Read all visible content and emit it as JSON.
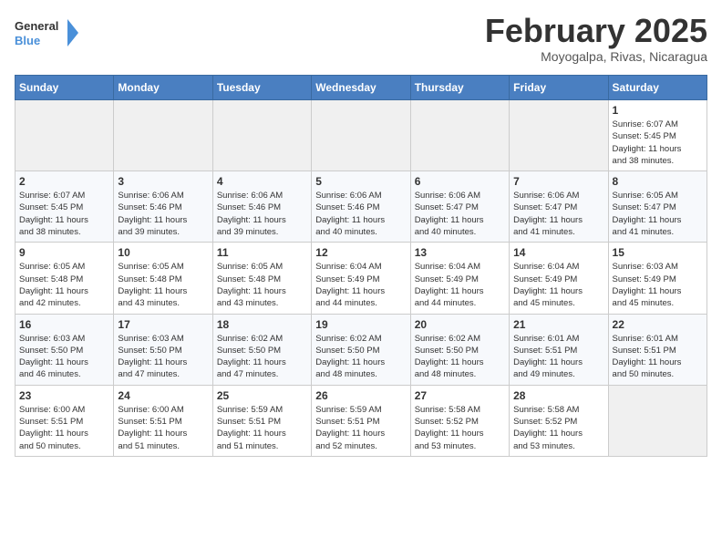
{
  "header": {
    "logo_line1": "General",
    "logo_line2": "Blue",
    "month": "February 2025",
    "location": "Moyogalpa, Rivas, Nicaragua"
  },
  "weekdays": [
    "Sunday",
    "Monday",
    "Tuesday",
    "Wednesday",
    "Thursday",
    "Friday",
    "Saturday"
  ],
  "weeks": [
    [
      {
        "day": "",
        "info": ""
      },
      {
        "day": "",
        "info": ""
      },
      {
        "day": "",
        "info": ""
      },
      {
        "day": "",
        "info": ""
      },
      {
        "day": "",
        "info": ""
      },
      {
        "day": "",
        "info": ""
      },
      {
        "day": "1",
        "info": "Sunrise: 6:07 AM\nSunset: 5:45 PM\nDaylight: 11 hours\nand 38 minutes."
      }
    ],
    [
      {
        "day": "2",
        "info": "Sunrise: 6:07 AM\nSunset: 5:45 PM\nDaylight: 11 hours\nand 38 minutes."
      },
      {
        "day": "3",
        "info": "Sunrise: 6:06 AM\nSunset: 5:46 PM\nDaylight: 11 hours\nand 39 minutes."
      },
      {
        "day": "4",
        "info": "Sunrise: 6:06 AM\nSunset: 5:46 PM\nDaylight: 11 hours\nand 39 minutes."
      },
      {
        "day": "5",
        "info": "Sunrise: 6:06 AM\nSunset: 5:46 PM\nDaylight: 11 hours\nand 40 minutes."
      },
      {
        "day": "6",
        "info": "Sunrise: 6:06 AM\nSunset: 5:47 PM\nDaylight: 11 hours\nand 40 minutes."
      },
      {
        "day": "7",
        "info": "Sunrise: 6:06 AM\nSunset: 5:47 PM\nDaylight: 11 hours\nand 41 minutes."
      },
      {
        "day": "8",
        "info": "Sunrise: 6:05 AM\nSunset: 5:47 PM\nDaylight: 11 hours\nand 41 minutes."
      }
    ],
    [
      {
        "day": "9",
        "info": "Sunrise: 6:05 AM\nSunset: 5:48 PM\nDaylight: 11 hours\nand 42 minutes."
      },
      {
        "day": "10",
        "info": "Sunrise: 6:05 AM\nSunset: 5:48 PM\nDaylight: 11 hours\nand 43 minutes."
      },
      {
        "day": "11",
        "info": "Sunrise: 6:05 AM\nSunset: 5:48 PM\nDaylight: 11 hours\nand 43 minutes."
      },
      {
        "day": "12",
        "info": "Sunrise: 6:04 AM\nSunset: 5:49 PM\nDaylight: 11 hours\nand 44 minutes."
      },
      {
        "day": "13",
        "info": "Sunrise: 6:04 AM\nSunset: 5:49 PM\nDaylight: 11 hours\nand 44 minutes."
      },
      {
        "day": "14",
        "info": "Sunrise: 6:04 AM\nSunset: 5:49 PM\nDaylight: 11 hours\nand 45 minutes."
      },
      {
        "day": "15",
        "info": "Sunrise: 6:03 AM\nSunset: 5:49 PM\nDaylight: 11 hours\nand 45 minutes."
      }
    ],
    [
      {
        "day": "16",
        "info": "Sunrise: 6:03 AM\nSunset: 5:50 PM\nDaylight: 11 hours\nand 46 minutes."
      },
      {
        "day": "17",
        "info": "Sunrise: 6:03 AM\nSunset: 5:50 PM\nDaylight: 11 hours\nand 47 minutes."
      },
      {
        "day": "18",
        "info": "Sunrise: 6:02 AM\nSunset: 5:50 PM\nDaylight: 11 hours\nand 47 minutes."
      },
      {
        "day": "19",
        "info": "Sunrise: 6:02 AM\nSunset: 5:50 PM\nDaylight: 11 hours\nand 48 minutes."
      },
      {
        "day": "20",
        "info": "Sunrise: 6:02 AM\nSunset: 5:50 PM\nDaylight: 11 hours\nand 48 minutes."
      },
      {
        "day": "21",
        "info": "Sunrise: 6:01 AM\nSunset: 5:51 PM\nDaylight: 11 hours\nand 49 minutes."
      },
      {
        "day": "22",
        "info": "Sunrise: 6:01 AM\nSunset: 5:51 PM\nDaylight: 11 hours\nand 50 minutes."
      }
    ],
    [
      {
        "day": "23",
        "info": "Sunrise: 6:00 AM\nSunset: 5:51 PM\nDaylight: 11 hours\nand 50 minutes."
      },
      {
        "day": "24",
        "info": "Sunrise: 6:00 AM\nSunset: 5:51 PM\nDaylight: 11 hours\nand 51 minutes."
      },
      {
        "day": "25",
        "info": "Sunrise: 5:59 AM\nSunset: 5:51 PM\nDaylight: 11 hours\nand 51 minutes."
      },
      {
        "day": "26",
        "info": "Sunrise: 5:59 AM\nSunset: 5:51 PM\nDaylight: 11 hours\nand 52 minutes."
      },
      {
        "day": "27",
        "info": "Sunrise: 5:58 AM\nSunset: 5:52 PM\nDaylight: 11 hours\nand 53 minutes."
      },
      {
        "day": "28",
        "info": "Sunrise: 5:58 AM\nSunset: 5:52 PM\nDaylight: 11 hours\nand 53 minutes."
      },
      {
        "day": "",
        "info": ""
      }
    ]
  ]
}
